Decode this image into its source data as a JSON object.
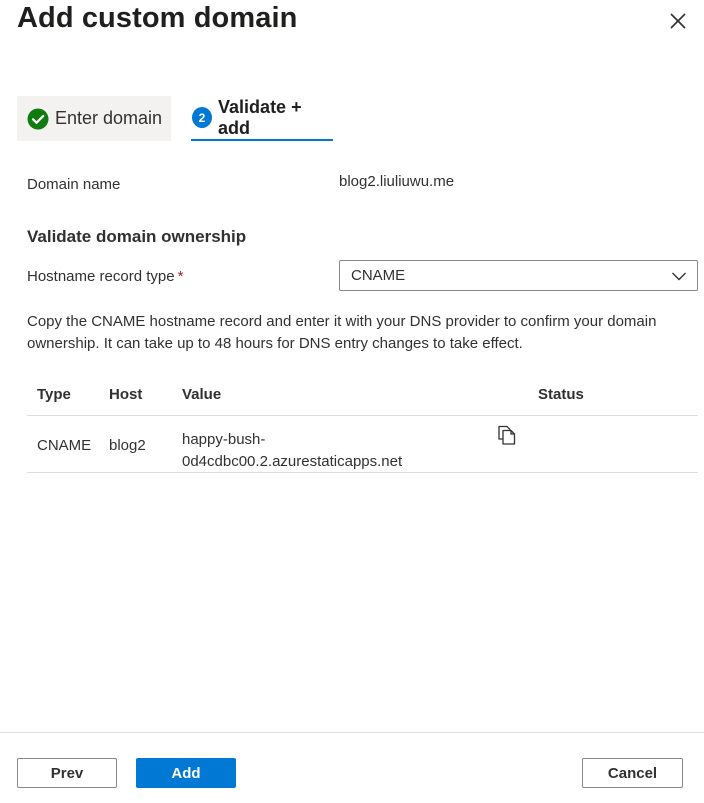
{
  "dialog": {
    "title": "Add custom domain"
  },
  "steps": [
    {
      "label": "Enter domain",
      "status": "complete"
    },
    {
      "number": "2",
      "label": "Validate + add",
      "status": "active"
    }
  ],
  "domain": {
    "label": "Domain name",
    "value": "blog2.liuliuwu.me"
  },
  "validation": {
    "section_title": "Validate domain ownership",
    "record_type_label": "Hostname record type",
    "required_marker": "*",
    "record_type_value": "CNAME",
    "description": "Copy the CNAME hostname record and enter it with your DNS provider to confirm your domain ownership. It can take up to 48 hours for DNS entry changes to take effect."
  },
  "table": {
    "columns": [
      "Type",
      "Host",
      "Value",
      "Status"
    ],
    "rows": [
      {
        "type": "CNAME",
        "host": "blog2",
        "value_line1": "happy-bush-",
        "value_line2": "0d4cdbc00.2.azurestaticapps.net",
        "status": ""
      }
    ]
  },
  "footer": {
    "prev_label": "Prev",
    "add_label": "Add",
    "cancel_label": "Cancel"
  },
  "colors": {
    "accent": "#0078d4",
    "success": "#107c10",
    "required": "#a4262c"
  },
  "icons": {
    "close": "close-icon",
    "step_complete": "checkmark-circle-icon",
    "dropdown": "chevron-down-icon",
    "copy": "copy-icon"
  }
}
